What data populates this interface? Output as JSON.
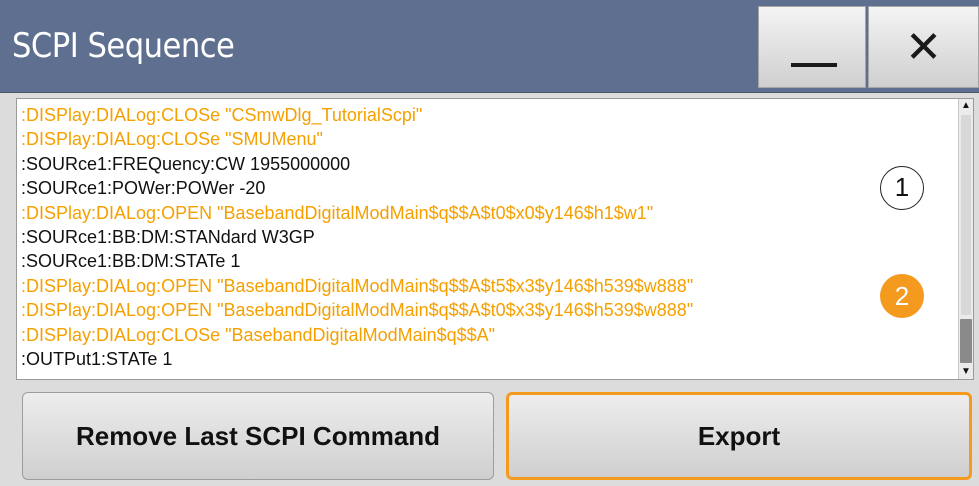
{
  "window": {
    "title": "SCPI Sequence",
    "minimize_symbol": "—",
    "close_symbol": "✕"
  },
  "sequence": {
    "lines": [
      {
        "text": ":DISPlay:DIALog:CLOSe \"CSmwDlg_TutorialScpi\"",
        "color": "orange"
      },
      {
        "text": ":DISPlay:DIALog:CLOSe \"SMUMenu\"",
        "color": "orange"
      },
      {
        "text": ":SOURce1:FREQuency:CW 1955000000",
        "color": "black"
      },
      {
        "text": ":SOURce1:POWer:POWer -20",
        "color": "black"
      },
      {
        "text": ":DISPlay:DIALog:OPEN \"BasebandDigitalModMain$q$$A$t0$x0$y146$h1$w1\"",
        "color": "orange"
      },
      {
        "text": ":SOURce1:BB:DM:STANdard W3GP",
        "color": "black"
      },
      {
        "text": ":SOURce1:BB:DM:STATe 1",
        "color": "black"
      },
      {
        "text": ":DISPlay:DIALog:OPEN \"BasebandDigitalModMain$q$$A$t5$x3$y146$h539$w888\"",
        "color": "orange"
      },
      {
        "text": ":DISPlay:DIALog:OPEN \"BasebandDigitalModMain$q$$A$t0$x3$y146$h539$w888\"",
        "color": "orange"
      },
      {
        "text": ":DISPlay:DIALog:CLOSe \"BasebandDigitalModMain$q$$A\"",
        "color": "orange"
      },
      {
        "text": ":OUTPut1:STATe 1",
        "color": "black"
      }
    ]
  },
  "badges": {
    "one": "1",
    "two": "2"
  },
  "buttons": {
    "remove_label": "Remove Last SCPI Command",
    "export_label": "Export"
  },
  "colors": {
    "titlebar": "#5f6f8f",
    "highlight": "#f39a1f",
    "command_orange": "#f5a000"
  },
  "icons": {
    "minimize": "minimize-icon",
    "close": "close-icon",
    "scroll_up": "scroll-up-arrow-icon",
    "scroll_down": "scroll-down-arrow-icon"
  }
}
